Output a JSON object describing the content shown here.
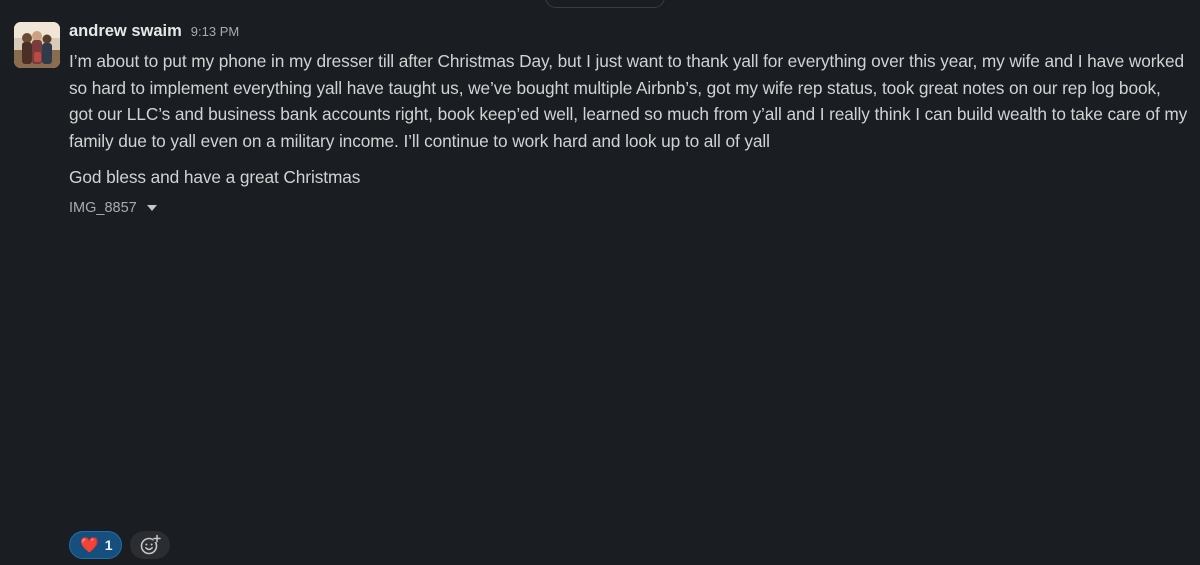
{
  "message": {
    "sender": "andrew swaim",
    "time": "9:13 PM",
    "paragraphs": [
      "I’m about to put my phone in my dresser till after Christmas Day, but I just want to thank yall for everything over this year, my wife and I have worked so hard to implement everything yall have taught us, we’ve bought multiple Airbnb’s, got my wife rep status, took great notes on our rep log book, got our LLC’s and business bank accounts right, book keep’ed well, learned so much from y’all and I really think I can build wealth to take care of my family due to yall even on a military income. I’ll continue to work hard and look up to all of yall",
      "God bless and have a great Christmas"
    ],
    "attachment_name": "IMG_8857"
  },
  "reactions": [
    {
      "emoji": "❤️",
      "emoji_name": "heart-icon",
      "count": "1"
    }
  ],
  "icons": {
    "add_reaction": "add-reaction-icon",
    "attachment_toggle": "caret-down-icon"
  },
  "colors": {
    "background": "#1a1d21",
    "reaction_active_bg": "#164f7e",
    "reaction_active_border": "#1d6fa8",
    "text": "#d1d2d3"
  }
}
